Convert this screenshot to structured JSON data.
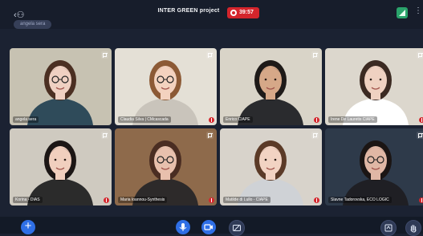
{
  "header": {
    "back_icon": "back-arrow-user-icon",
    "title": "INTER GREEN project",
    "recording_time": "39:57",
    "more_icon": "more-vertical-icon"
  },
  "self_tag": {
    "name": "angela sera"
  },
  "participants": [
    {
      "name": "angela sera",
      "bg": "#c7c2b2",
      "hair": "#4b2f22",
      "skin": "#efd0c2",
      "shirt": "#2f4b5a",
      "glasses": true
    },
    {
      "name": "Claudia Silva | CMcascada",
      "bg": "#e4e0d6",
      "hair": "#8c5a36",
      "skin": "#f3d2bf",
      "shirt": "#c9c4bb",
      "glasses": true
    },
    {
      "name": "Enrico CIAPE",
      "bg": "#d9d4c8",
      "hair": "#1e1a18",
      "skin": "#d6a888",
      "shirt": "#2a2b2e",
      "glasses": false
    },
    {
      "name": "Irene De Lauretis CIAPE",
      "bg": "#dcd7cd",
      "hair": "#3b2a22",
      "skin": "#efd1c1",
      "shirt": "#ffffff",
      "glasses": false
    },
    {
      "name": "Korina - DIAS",
      "bg": "#cfcac0",
      "hair": "#1c1615",
      "skin": "#f1cfbe",
      "shirt": "#2b2b2b",
      "glasses": false
    },
    {
      "name": "Maria Ioannou-Synthesis",
      "bg": "#8e6a4b",
      "hair": "#4a2d22",
      "skin": "#e8c0ad",
      "shirt": "#2d2a2a",
      "glasses": true
    },
    {
      "name": "Matilde di Lullo - CIAPE",
      "bg": "#d8d3cb",
      "hair": "#5b3a27",
      "skin": "#f2d3c3",
      "shirt": "#cfd2d6",
      "glasses": false
    },
    {
      "name": "Slavne Tadorovska, ECO LOGIC",
      "bg": "#2e3a4a",
      "hair": "#1b1514",
      "skin": "#e0b7a5",
      "shirt": "#1f1f24",
      "glasses": true
    }
  ],
  "controls": {
    "add": "add-icon",
    "mic": "microphone-icon",
    "camera": "camera-icon",
    "screen": "screen-share-icon",
    "layout": "layout-icon",
    "hand": "raise-hand-icon"
  },
  "colors": {
    "record": "#d4252c",
    "accent": "#2f6fe6",
    "background": "#1b2232"
  }
}
